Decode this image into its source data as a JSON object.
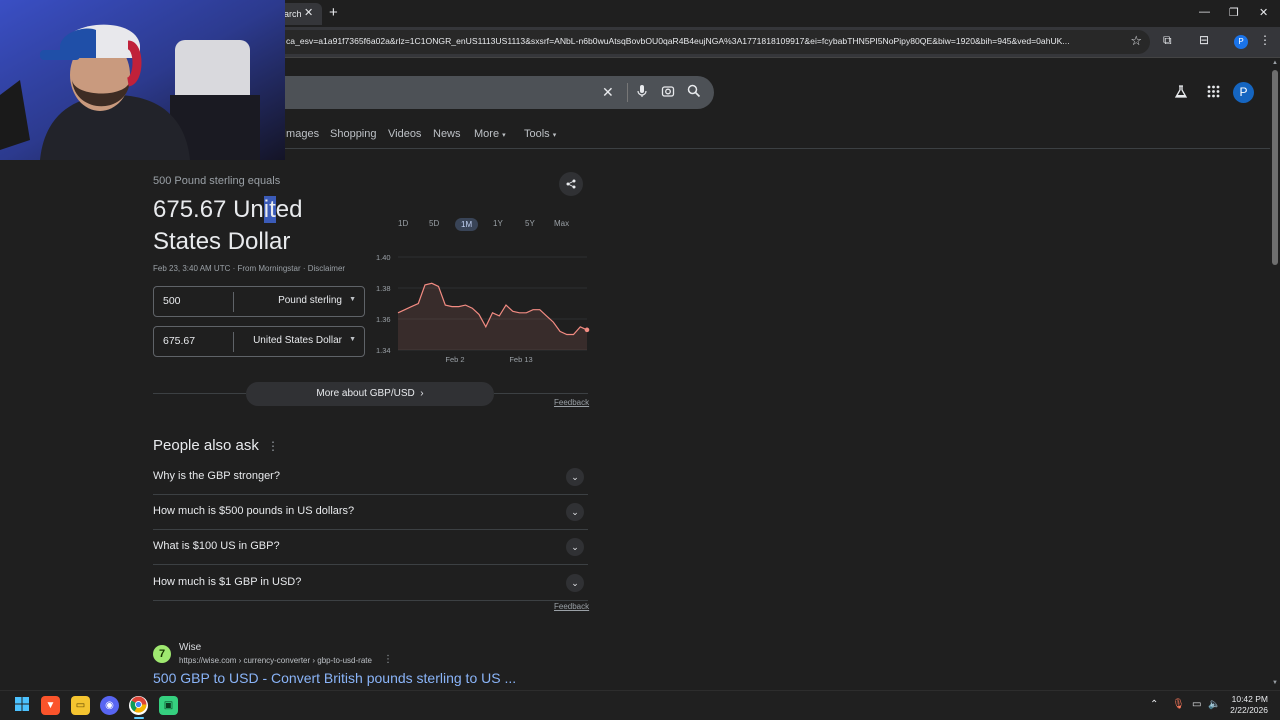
{
  "browser": {
    "tab_title": "arch",
    "url": "ca_esv=a1a91f7365f6a02a&rlz=1C1ONGR_enUS1113US1113&sxsrf=ANbL-n6b0wuAtsqBovbOU0qaR4B4eujNGA%3A1771818109917&ei=fcybabTHN5PI5NoPipy80QE&biw=1920&bih=945&ved=0ahUK...",
    "profile_initial": "P"
  },
  "header": {
    "avatar_initial": "P",
    "tabs": [
      "Images",
      "Shopping",
      "Videos",
      "News",
      "More",
      "Tools"
    ]
  },
  "converter": {
    "subtitle": "500 Pound sterling equals",
    "value_prefix": "675.67 Un",
    "value_highlight": "it",
    "value_suffix": "ed",
    "value_line2": "States Dollar",
    "date": "Feb 23, 3:40 AM UTC",
    "source": "From Morningstar",
    "disclaimer": "Disclaimer",
    "from_amount": "500",
    "from_currency": "Pound sterling",
    "to_amount": "675.67",
    "to_currency": "United States Dollar",
    "ranges": [
      "1D",
      "5D",
      "1M",
      "1Y",
      "5Y",
      "Max"
    ],
    "active_range": "1M",
    "more_about": "More about GBP/USD",
    "feedback": "Feedback"
  },
  "chart_data": {
    "type": "line",
    "y_ticks": [
      "1.40",
      "1.38",
      "1.36",
      "1.34"
    ],
    "x_ticks": [
      "Feb 2",
      "Feb 13"
    ],
    "ylim": [
      1.34,
      1.4
    ],
    "values": [
      1.364,
      1.366,
      1.368,
      1.37,
      1.382,
      1.383,
      1.381,
      1.369,
      1.368,
      1.368,
      1.369,
      1.367,
      1.363,
      1.355,
      1.364,
      1.362,
      1.369,
      1.365,
      1.364,
      1.364,
      1.366,
      1.366,
      1.362,
      1.358,
      1.352,
      1.35,
      1.35,
      1.355,
      1.353
    ],
    "color": "#f28b82"
  },
  "paa": {
    "title": "People also ask",
    "questions": [
      "Why is the GBP stronger?",
      "How much is $500 pounds in US dollars?",
      "What is $100 US in GBP?",
      "How much is $1 GBP in USD?"
    ],
    "feedback": "Feedback"
  },
  "result": {
    "site_name": "Wise",
    "cite": "https://wise.com › currency-converter › gbp-to-usd-rate",
    "title": "500 GBP to USD - Convert British pounds sterling to US ..."
  },
  "taskbar": {
    "time": "10:42 PM",
    "date": "2/22/2026"
  }
}
